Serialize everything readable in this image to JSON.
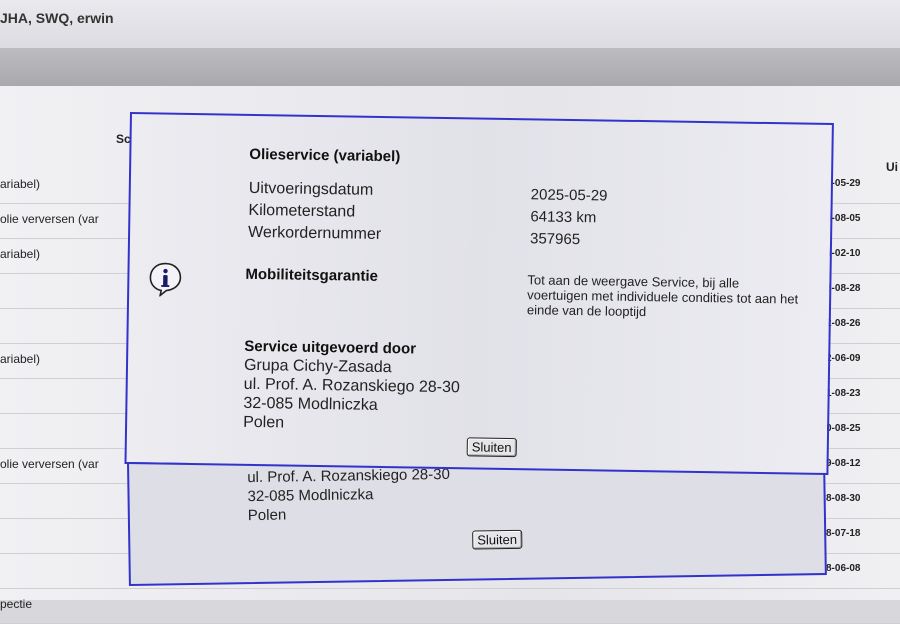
{
  "window": {
    "title": "JHA, SWQ, erwin"
  },
  "table": {
    "headers": {
      "left": "Sc",
      "right": "Ui"
    },
    "rows": [
      {
        "left": "ariabel)",
        "date": "5-05-29"
      },
      {
        "left": "olie verversen (var",
        "date": "4-08-05"
      },
      {
        "left": "ariabel)",
        "date": "4-02-10"
      },
      {
        "left": "",
        "date": "3-08-28"
      },
      {
        "left": "",
        "date": "2-08-26"
      },
      {
        "left": "ariabel)",
        "date": "2-06-09"
      },
      {
        "left": "",
        "date": "1-08-23"
      },
      {
        "left": "",
        "date": "0-08-25"
      },
      {
        "left": "olie verversen (var",
        "date": "9-08-12"
      },
      {
        "left": "",
        "date": "8-08-30"
      },
      {
        "left": "",
        "date": "8-07-18"
      },
      {
        "left": "",
        "date": "8-06-08"
      },
      {
        "left": "pectie",
        "date": ""
      }
    ]
  },
  "dialog": {
    "title": "Olieservice (variabel)",
    "fields": [
      {
        "label": "Uitvoeringsdatum",
        "value": "2025-05-29"
      },
      {
        "label": "Kilometerstand",
        "value": "64133 km"
      },
      {
        "label": "Werkordernummer",
        "value": "357965"
      }
    ],
    "mobility": {
      "label": "Mobiliteitsgarantie",
      "value": "Tot aan de weergave Service, bij alle voertuigen met individuele condities tot aan het einde van de looptijd"
    },
    "service": {
      "title": "Service uitgevoerd door",
      "address": [
        "Grupa Cichy-Zasada",
        "ul. Prof. A. Rozanskiego 28-30",
        "32-085 Modlniczka",
        "Polen"
      ]
    },
    "close_label": "Sluiten",
    "icon": "info-icon"
  },
  "dialog_back": {
    "address": [
      "ul. Prof. A. Rozanskiego 28-30",
      "32-085 Modlniczka",
      "Polen"
    ],
    "close_label": "Sluiten"
  }
}
